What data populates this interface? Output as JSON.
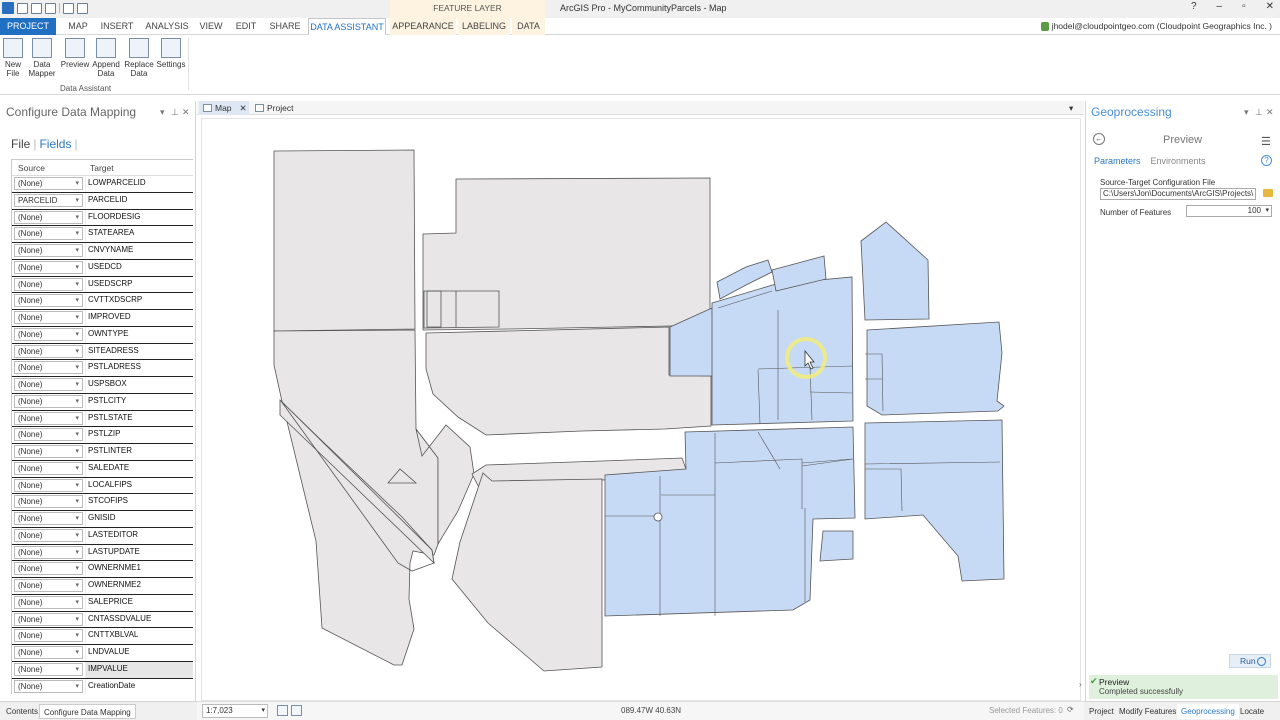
{
  "app_title": "ArcGIS Pro - MyCommunityParcels - Map",
  "contextual_header": "FEATURE LAYER",
  "window_controls": {
    "help": "?",
    "minimize": "–",
    "restore": "▫",
    "close": "✕"
  },
  "ribbon_tabs": [
    "PROJECT",
    "MAP",
    "INSERT",
    "ANALYSIS",
    "VIEW",
    "EDIT",
    "SHARE",
    "DATA ASSISTANT",
    "APPEARANCE",
    "LABELING",
    "DATA"
  ],
  "user": "jhodel@cloudpointgeo.com (Cloudpoint Geographics Inc. )",
  "ribbon": {
    "buttons": [
      {
        "line1": "New",
        "line2": "File"
      },
      {
        "line1": "Data",
        "line2": "Mapper"
      },
      {
        "line1": "Preview",
        "line2": ""
      },
      {
        "line1": "Append",
        "line2": "Data"
      },
      {
        "line1": "Replace",
        "line2": "Data"
      },
      {
        "line1": "Settings",
        "line2": ""
      }
    ],
    "group_label": "Data Assistant"
  },
  "left_panel": {
    "title": "Configure Data Mapping",
    "tab_file": "File",
    "tab_fields": "Fields",
    "col_source": "Source",
    "col_target": "Target",
    "rows": [
      {
        "source": "(None)",
        "target": "LOWPARCELID"
      },
      {
        "source": "PARCELID",
        "target": "PARCELID"
      },
      {
        "source": "(None)",
        "target": "FLOORDESIG"
      },
      {
        "source": "(None)",
        "target": "STATEAREA"
      },
      {
        "source": "(None)",
        "target": "CNVYNAME"
      },
      {
        "source": "(None)",
        "target": "USEDCD"
      },
      {
        "source": "(None)",
        "target": "USEDSCRP"
      },
      {
        "source": "(None)",
        "target": "CVTTXDSCRP"
      },
      {
        "source": "(None)",
        "target": "IMPROVED"
      },
      {
        "source": "(None)",
        "target": "OWNTYPE"
      },
      {
        "source": "(None)",
        "target": "SITEADRESS"
      },
      {
        "source": "(None)",
        "target": "PSTLADRESS"
      },
      {
        "source": "(None)",
        "target": "USPSBOX"
      },
      {
        "source": "(None)",
        "target": "PSTLCITY"
      },
      {
        "source": "(None)",
        "target": "PSTLSTATE"
      },
      {
        "source": "(None)",
        "target": "PSTLZIP"
      },
      {
        "source": "(None)",
        "target": "PSTLINTER"
      },
      {
        "source": "(None)",
        "target": "SALEDATE"
      },
      {
        "source": "(None)",
        "target": "LOCALFIPS"
      },
      {
        "source": "(None)",
        "target": "STCOFIPS"
      },
      {
        "source": "(None)",
        "target": "GNISID"
      },
      {
        "source": "(None)",
        "target": "LASTEDITOR"
      },
      {
        "source": "(None)",
        "target": "LASTUPDATE"
      },
      {
        "source": "(None)",
        "target": "OWNERNME1"
      },
      {
        "source": "(None)",
        "target": "OWNERNME2"
      },
      {
        "source": "(None)",
        "target": "SALEPRICE"
      },
      {
        "source": "(None)",
        "target": "CNTASSDVALUE"
      },
      {
        "source": "(None)",
        "target": "CNTTXBLVAL"
      },
      {
        "source": "(None)",
        "target": "LNDVALUE"
      },
      {
        "source": "(None)",
        "target": "IMPVALUE"
      },
      {
        "source": "(None)",
        "target": "CreationDate"
      }
    ]
  },
  "map_tabs": [
    {
      "label": "Map"
    },
    {
      "label": "Project"
    }
  ],
  "map_status": {
    "scale": "1:7,023",
    "coordinates": "089.47W 40.63N",
    "selected": "Selected Features: 0"
  },
  "geoprocessing": {
    "title": "Geoprocessing",
    "tool": "Preview",
    "tab_parameters": "Parameters",
    "tab_environments": "Environments",
    "config_label": "Source-Target Configuration File",
    "config_value": "C:\\Users\\Jon\\Documents\\ArcGIS\\Projects\\",
    "features_label": "Number of Features",
    "features_value": "100",
    "run_label": "Run",
    "status_title": "Preview",
    "status_msg": "Completed successfully"
  },
  "bottom_left_tabs": [
    "Contents",
    "Configure Data Mapping"
  ],
  "bottom_right_tabs": [
    "Project",
    "Modify Features",
    "Geoprocessing",
    "Locate"
  ],
  "colors": {
    "accent": "#1f6fc2",
    "parcel_fill": "#e8e6e7",
    "selected_fill": "#c7daf5",
    "status_ok": "#dff1dc"
  }
}
